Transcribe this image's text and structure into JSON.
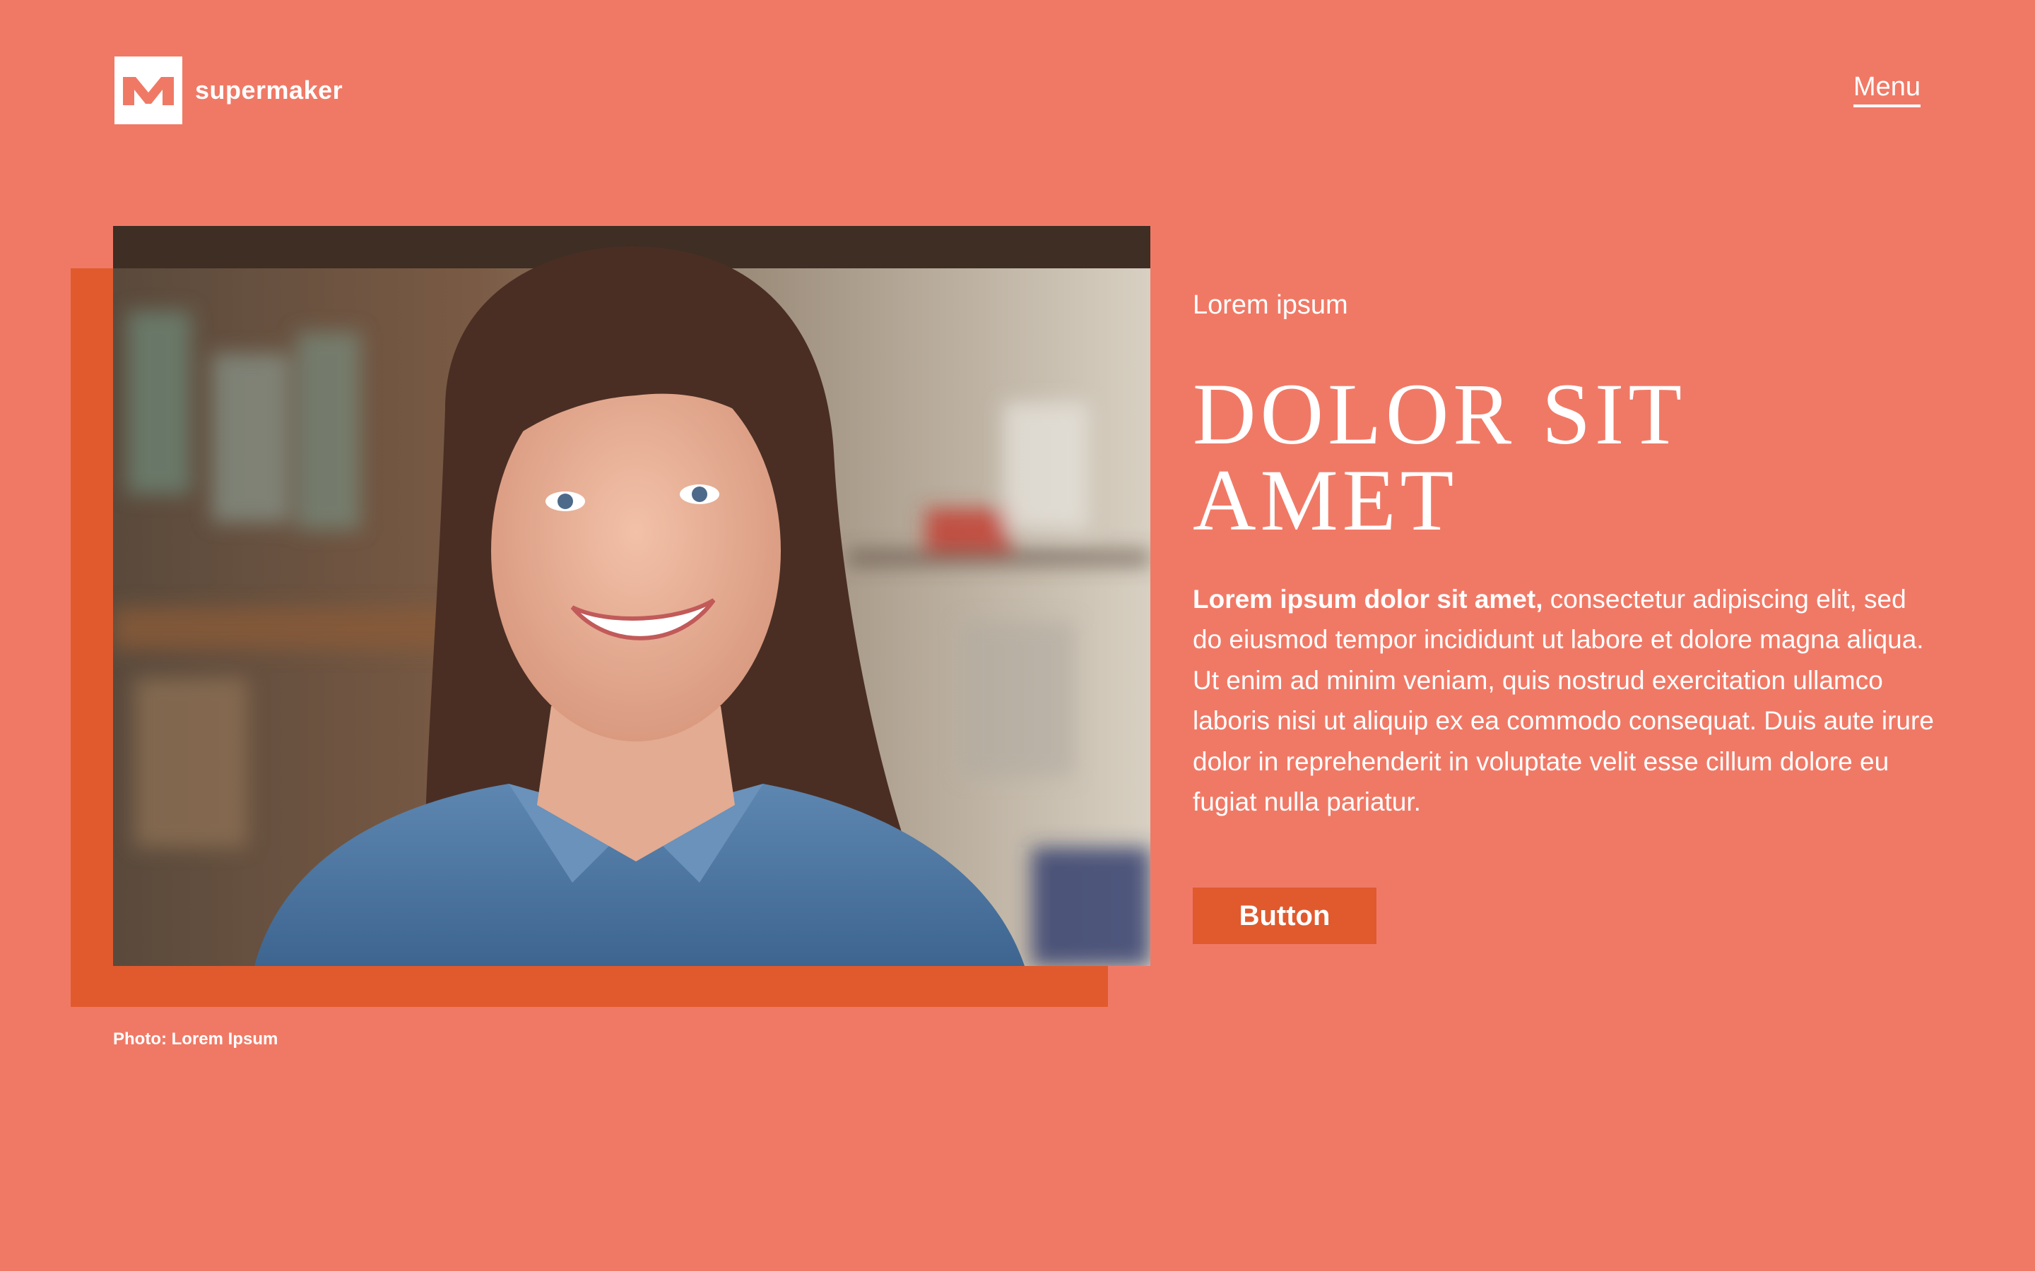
{
  "brand": {
    "name": "supermaker",
    "logo_icon": "m-logo-icon"
  },
  "header": {
    "menu_label": "Menu"
  },
  "hero": {
    "photo_icon": "portrait-photo",
    "photo_caption": "Photo: Lorem Ipsum",
    "eyebrow": "Lorem ipsum",
    "headline": "DOLOR SIT AMET",
    "body_bold": "Lorem ipsum dolor sit amet,",
    "body_rest": " consectetur adipiscing elit, sed do eiusmod tempor incididunt ut labore et dolore magna aliqua. Ut enim ad minim veniam, quis nostrud exercitation ullamco laboris nisi ut aliquip ex ea commodo consequat. Duis aute irure dolor in reprehenderit in voluptate velit esse cillum dolore eu fugiat nulla pariatur.",
    "button_label": "Button"
  },
  "colors": {
    "background": "#f07966",
    "accent": "#e05a2e",
    "text": "#ffffff"
  }
}
